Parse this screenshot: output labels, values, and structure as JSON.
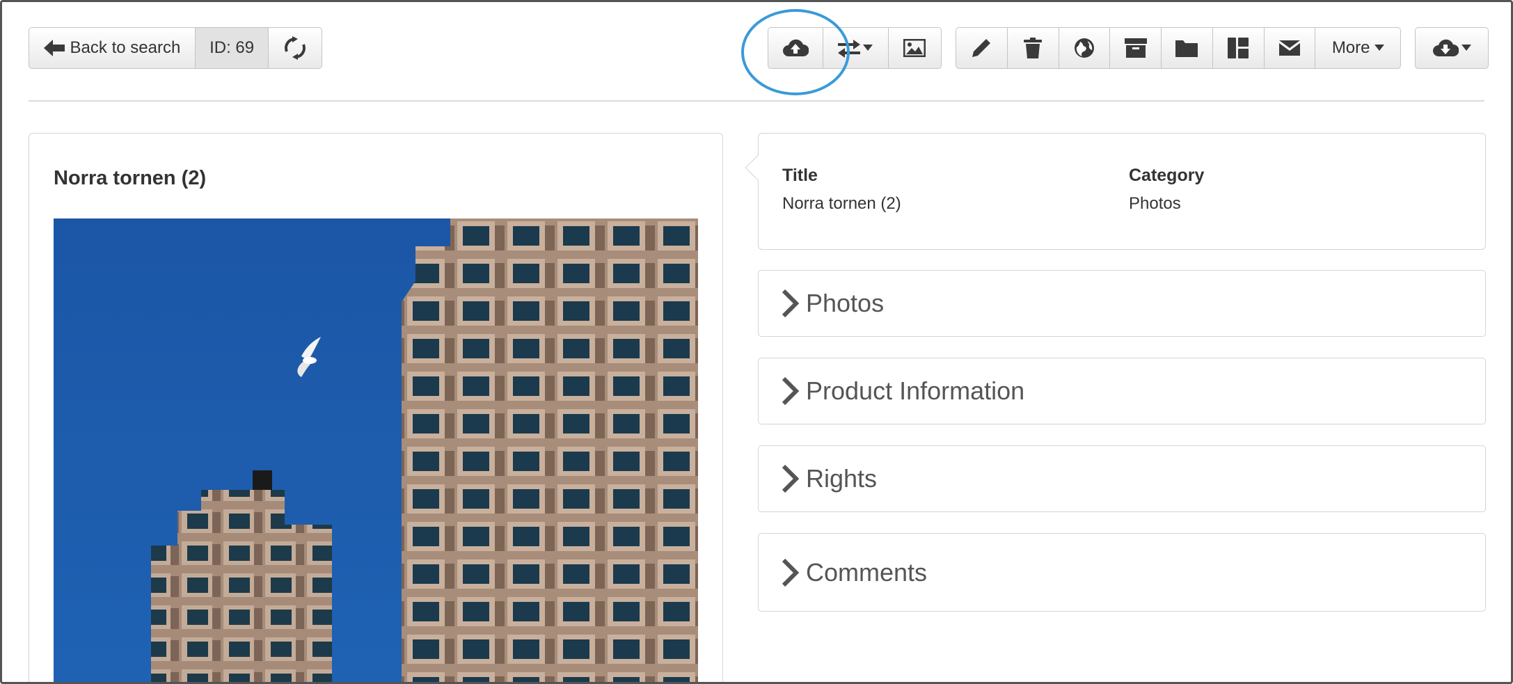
{
  "toolbar": {
    "back_label": "Back to search",
    "id_label": "ID: 69",
    "more_label": "More"
  },
  "asset": {
    "title": "Norra tornen (2)"
  },
  "info": {
    "title_label": "Title",
    "title_value": "Norra tornen (2)",
    "category_label": "Category",
    "category_value": "Photos"
  },
  "sections": [
    {
      "label": "Photos"
    },
    {
      "label": "Product Information"
    },
    {
      "label": "Rights"
    },
    {
      "label": "Comments"
    }
  ],
  "colors": {
    "highlight": "#3a9ad9",
    "sky": "#1f5aa8",
    "building": "#b89e8c"
  },
  "icons": [
    "arrow-left-icon",
    "refresh-icon",
    "cloud-upload-icon",
    "swap-icon",
    "image-icon",
    "pencil-icon",
    "trash-icon",
    "globe-icon",
    "archive-icon",
    "folder-icon",
    "layout-icon",
    "envelope-icon",
    "caret-down-icon",
    "cloud-download-icon",
    "chevron-right-icon"
  ]
}
